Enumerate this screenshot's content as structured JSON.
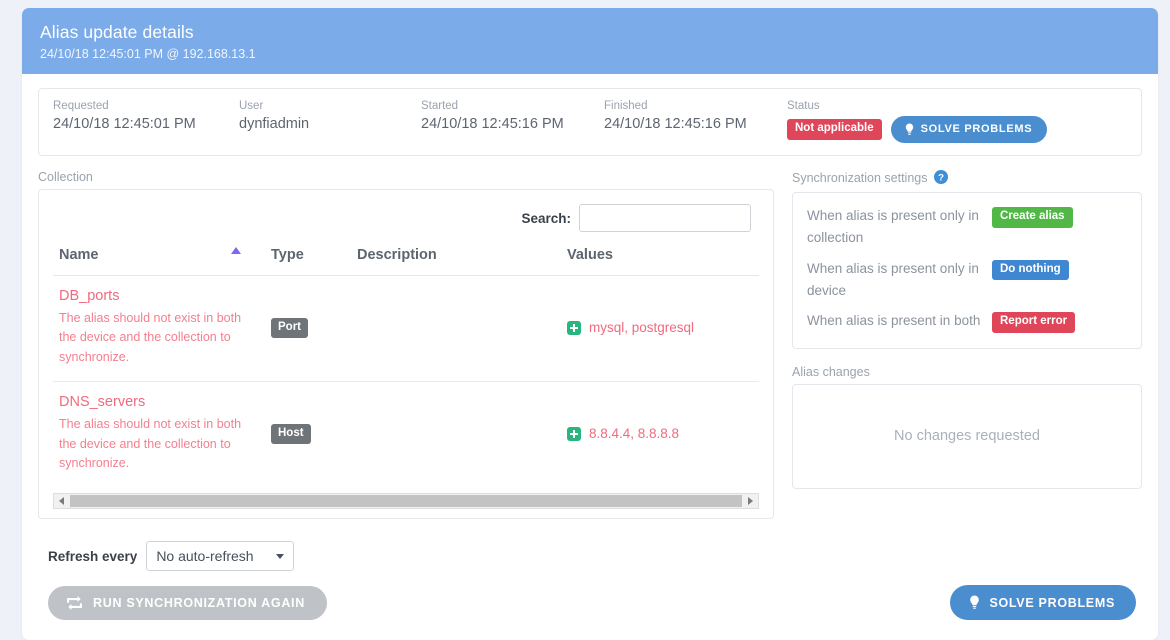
{
  "header": {
    "title": "Alias update details",
    "subtitle": "24/10/18 12:45:01 PM @ 192.168.13.1"
  },
  "info": {
    "requested_label": "Requested",
    "requested_value": "24/10/18 12:45:01 PM",
    "user_label": "User",
    "user_value": "dynfiadmin",
    "started_label": "Started",
    "started_value": "24/10/18 12:45:16 PM",
    "finished_label": "Finished",
    "finished_value": "24/10/18 12:45:16 PM",
    "status_label": "Status",
    "status_badge": "Not applicable",
    "solve_button": "SOLVE PROBLEMS"
  },
  "collection": {
    "label": "Collection",
    "search_label": "Search:",
    "search_value": "",
    "search_placeholder": "",
    "columns": {
      "name": "Name",
      "type": "Type",
      "description": "Description",
      "values": "Values"
    },
    "rows": [
      {
        "name": "DB_ports",
        "note": "The alias should not exist in both the device and the collection to synchronize.",
        "type": "Port",
        "description": "",
        "values": "mysql, postgresql"
      },
      {
        "name": "DNS_servers",
        "note": "The alias should not exist in both the device and the collection to synchronize.",
        "type": "Host",
        "description": "",
        "values": "8.8.4.4, 8.8.8.8"
      }
    ]
  },
  "sync_settings": {
    "label": "Synchronization settings",
    "rows": [
      {
        "text": "When alias is present only in collection",
        "badge": "Create alias",
        "color": "green"
      },
      {
        "text": "When alias is present only in device",
        "badge": "Do nothing",
        "color": "blue"
      },
      {
        "text": "When alias is present in both",
        "badge": "Report error",
        "color": "red"
      }
    ]
  },
  "alias_changes": {
    "label": "Alias changes",
    "empty_text": "No changes requested"
  },
  "footer": {
    "refresh_label": "Refresh every",
    "refresh_value": "No auto-refresh",
    "run_button": "RUN SYNCHRONIZATION AGAIN",
    "solve_button": "SOLVE PROBLEMS"
  },
  "colors": {
    "header_bg": "#7babe8",
    "accent_blue": "#4a8ed0",
    "danger_red": "#e04659",
    "success_green": "#51b848",
    "info_blue": "#3f87d0",
    "error_text": "#f16a7d",
    "sort_purple": "#7b68ee",
    "plus_green": "#29b57e"
  }
}
